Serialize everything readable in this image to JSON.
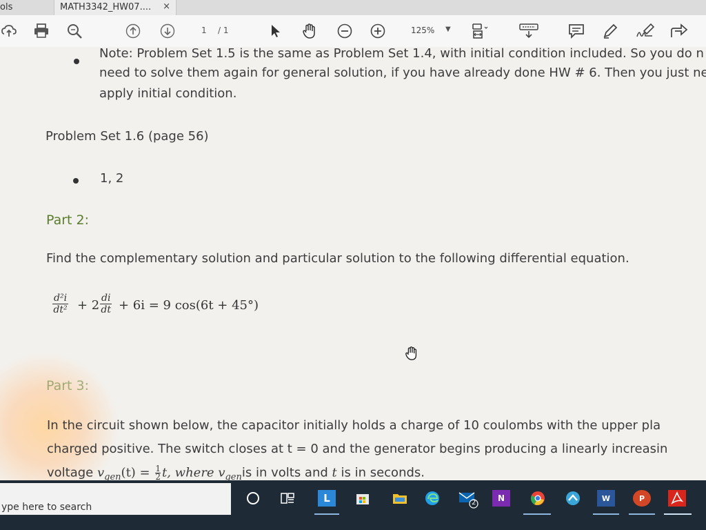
{
  "tabs": {
    "tools_label": "ols",
    "document_tab": "MATH3342_HW07....",
    "close_glyph": "×"
  },
  "toolbar": {
    "page_current": "1",
    "page_total": "/ 1",
    "zoom": "125%"
  },
  "document": {
    "note_line1": "Note: Problem Set 1.5 is the same as Problem Set 1.4, with initial condition included. So you do n",
    "note_line2": "need to solve them again for general solution, if you have already done HW # 6. Then you just ne",
    "note_line3": "apply initial condition.",
    "problem_set": "Problem Set 1.6 (page 56)",
    "problems": "1, 2",
    "part2_heading": "Part 2:",
    "part2_text": "Find the complementary solution and particular solution to the following differential equation.",
    "eq_frac1_num": "d²i",
    "eq_frac1_den": "dt²",
    "eq_plus2": "+ 2",
    "eq_frac2_num": "di",
    "eq_frac2_den": "dt",
    "eq_rest": "+ 6i = 9 cos(6t + 45°)",
    "part3_heading": "Part 3:",
    "part3_line1": "In the circuit shown below, the capacitor initially holds a charge of 10 coulombs with the upper pla",
    "part3_line2": "charged positive. The switch closes at t = 0 and the generator begins producing a linearly increasin",
    "part3_line3_a": "voltage ",
    "part3_line3_vgen": "v",
    "part3_line3_sub": "gen",
    "part3_line3_b": "(t) = ",
    "part3_line3_frac_num": "1",
    "part3_line3_frac_den": "2",
    "part3_line3_c": "t, where ",
    "part3_line3_d": "v",
    "part3_line3_sub2": "gen",
    "part3_line3_e": "is in volts and ",
    "part3_line3_t": "t",
    "part3_line3_f": " is in seconds."
  },
  "taskbar": {
    "search_placeholder": "ype here to search",
    "mail_badge": "2",
    "onenote_label": "N",
    "word_label": "W",
    "ppt_label": "P",
    "l_app_label": "L"
  },
  "colors": {
    "part_heading": "#5a7d2b",
    "taskbar_bg": "#1e2a36"
  }
}
